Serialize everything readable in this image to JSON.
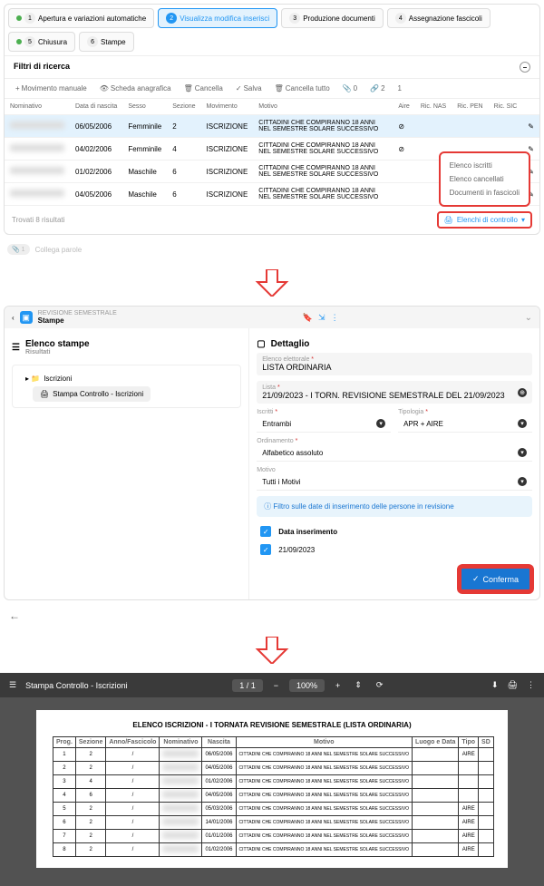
{
  "tabs": [
    {
      "num": "1",
      "label": "Apertura e variazioni automatiche",
      "green": true
    },
    {
      "num": "2",
      "label": "Visualizza modifica inserisci",
      "active": true
    },
    {
      "num": "3",
      "label": "Produzione documenti"
    },
    {
      "num": "4",
      "label": "Assegnazione fascicoli"
    },
    {
      "num": "5",
      "label": "Chiusura",
      "green": true
    },
    {
      "num": "6",
      "label": "Stampe"
    }
  ],
  "filter_hdr": "Filtri di ricerca",
  "toolbar": {
    "add": "Movimento manuale",
    "card": "Scheda anagrafica",
    "delete": "Cancella",
    "save": "Salva",
    "cancel_all": "Cancella tutto",
    "attach": "0",
    "links": "2",
    "more": "1"
  },
  "cols": {
    "nom": "Nominativo",
    "dob": "Data di nascita",
    "sex": "Sesso",
    "sec": "Sezione",
    "mov": "Movimento",
    "mot": "Motivo",
    "aire": "Aire",
    "ricnas": "Ric. NAS",
    "ricpen": "Ric. PEN",
    "ricsic": "Ric. SIC"
  },
  "rows": [
    {
      "dob": "06/05/2006",
      "sex": "Femminile",
      "sec": "2",
      "mov": "ISCRIZIONE",
      "mot": "CITTADINI CHE COMPIRANNO 18 ANNI NEL SEMESTRE SOLARE SUCCESSIVO",
      "aire": true,
      "sel": true
    },
    {
      "dob": "04/02/2006",
      "sex": "Femminile",
      "sec": "4",
      "mov": "ISCRIZIONE",
      "mot": "CITTADINI CHE COMPIRANNO 18 ANNI NEL SEMESTRE SOLARE SUCCESSIVO",
      "aire": true
    },
    {
      "dob": "01/02/2006",
      "sex": "Maschile",
      "sec": "6",
      "mov": "ISCRIZIONE",
      "mot": "CITTADINI CHE COMPIRANNO 18 ANNI NEL SEMESTRE SOLARE SUCCESSIVO"
    },
    {
      "dob": "04/05/2006",
      "sex": "Maschile",
      "sec": "6",
      "mov": "ISCRIZIONE",
      "mot": "CITTADINI CHE COMPIRANNO 18 ANNI NEL SEMESTRE SOLARE SUCCESSIVO"
    }
  ],
  "results_footer": "Trovati 8 risultati",
  "dropdown": {
    "items": [
      "Elenco iscritti",
      "Elenco cancellati",
      "Documenti in fascicoli"
    ],
    "trigger": "Elenchi di controllo"
  },
  "attach": {
    "count": "1",
    "link": "Collega parole"
  },
  "hdr2": {
    "crumb": "REVISIONE SEMESTRALE",
    "page": "Stampe"
  },
  "elenco": {
    "title": "Elenco stampe",
    "sub": "Risultati",
    "tree_root": "Iscrizioni",
    "tree_leaf": "Stampa Controllo - Iscrizioni"
  },
  "dettaglio": {
    "title": "Dettaglio",
    "dest_lbl": "Elenco elettorale",
    "dest_val": "LISTA ORDINARIA",
    "lista_lbl": "Lista",
    "lista_val": "21/09/2023 - I TORN. REVISIONE SEMESTRALE DEL 21/09/2023",
    "iscritti_lbl": "Iscritti",
    "iscritti_val": "Entrambi",
    "tipo_lbl": "Tipologia",
    "tipo_val": "APR + AIRE",
    "ord_lbl": "Ordinamento",
    "ord_val": "Alfabetico assoluto",
    "motivo_lbl": "Motivo",
    "motivo_val": "Tutti i Motivi",
    "info": "Filtro sulle date di inserimento delle persone in revisione",
    "check_lbl": "Data inserimento",
    "date_val": "21/09/2023",
    "confirm": "Conferma"
  },
  "pdf": {
    "title": "Stampa Controllo - Iscrizioni",
    "page_info": "1 / 1",
    "zoom": "100%",
    "doc_title": "ELENCO ISCRIZIONI - I TORNATA REVISIONE SEMESTRALE (LISTA ORDINARIA)",
    "cols": {
      "prog": "Prog.",
      "sec": "Sezione",
      "anno": "Anno/Fascicolo",
      "nom": "Nominativo",
      "nas": "Nascita",
      "mot": "Motivo",
      "luogo": "Luogo e Data",
      "tipo": "Tipo",
      "sd": "SD"
    },
    "rows": [
      {
        "p": "1",
        "s": "2",
        "a": "/",
        "n": "",
        "d": "06/05/2006",
        "m": "CITTADINI CHE COMPIRANNO 18 ANNI NEL SEMESTRE SOLARE SUCCESSIVO",
        "l": "",
        "t": "AIRE",
        "sd": ""
      },
      {
        "p": "2",
        "s": "2",
        "a": "/",
        "n": "",
        "d": "04/05/2006",
        "m": "CITTADINI CHE COMPIRANNO 18 ANNI NEL SEMESTRE SOLARE SUCCESSIVO",
        "l": "",
        "t": "",
        "sd": ""
      },
      {
        "p": "3",
        "s": "4",
        "a": "/",
        "n": "",
        "d": "01/02/2006",
        "m": "CITTADINI CHE COMPIRANNO 18 ANNI NEL SEMESTRE SOLARE SUCCESSIVO",
        "l": "",
        "t": "",
        "sd": ""
      },
      {
        "p": "4",
        "s": "6",
        "a": "/",
        "n": "",
        "d": "04/05/2006",
        "m": "CITTADINI CHE COMPIRANNO 18 ANNI NEL SEMESTRE SOLARE SUCCESSIVO",
        "l": "",
        "t": "",
        "sd": ""
      },
      {
        "p": "5",
        "s": "2",
        "a": "/",
        "n": "",
        "d": "05/03/2006",
        "m": "CITTADINI CHE COMPIRANNO 18 ANNI NEL SEMESTRE SOLARE SUCCESSIVO",
        "l": "",
        "t": "AIRE",
        "sd": ""
      },
      {
        "p": "6",
        "s": "2",
        "a": "/",
        "n": "",
        "d": "14/01/2006",
        "m": "CITTADINI CHE COMPIRANNO 18 ANNI NEL SEMESTRE SOLARE SUCCESSIVO",
        "l": "",
        "t": "AIRE",
        "sd": ""
      },
      {
        "p": "7",
        "s": "2",
        "a": "/",
        "n": "",
        "d": "01/01/2006",
        "m": "CITTADINI CHE COMPIRANNO 18 ANNI NEL SEMESTRE SOLARE SUCCESSIVO",
        "l": "",
        "t": "AIRE",
        "sd": ""
      },
      {
        "p": "8",
        "s": "2",
        "a": "/",
        "n": "",
        "d": "01/02/2006",
        "m": "CITTADINI CHE COMPIRANNO 18 ANNI NEL SEMESTRE SOLARE SUCCESSIVO",
        "l": "",
        "t": "AIRE",
        "sd": ""
      }
    ]
  }
}
